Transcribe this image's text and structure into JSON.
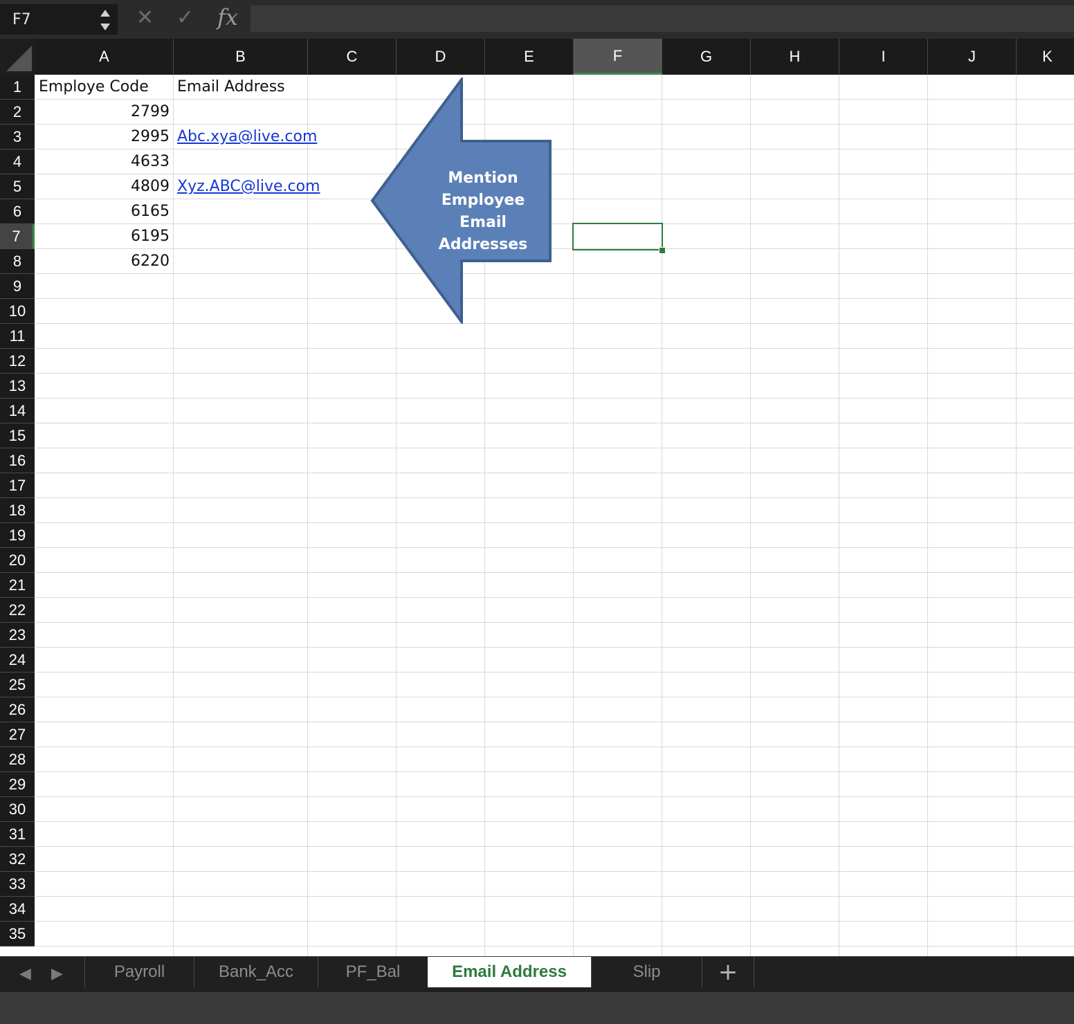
{
  "formula_bar": {
    "name_box": "F7",
    "cancel_icon": "✕",
    "confirm_icon": "✓",
    "fx_label": "fx",
    "formula_value": ""
  },
  "columns": [
    "A",
    "B",
    "C",
    "D",
    "E",
    "F",
    "G",
    "H",
    "I",
    "J",
    "K"
  ],
  "rows": [
    "1",
    "2",
    "3",
    "4",
    "5",
    "6",
    "7",
    "8",
    "9",
    "10",
    "11",
    "12",
    "13",
    "14",
    "15",
    "16",
    "17",
    "18",
    "19",
    "20",
    "21",
    "22",
    "23",
    "24",
    "25",
    "26",
    "27",
    "28",
    "29",
    "30",
    "31",
    "32",
    "33",
    "34",
    "35"
  ],
  "active_cell": {
    "column": "F",
    "row": "7"
  },
  "cells": {
    "A1": "Employe Code",
    "B1": "Email Address",
    "A2": "2799",
    "A3": "2995",
    "B3": "Abc.xya@live.com",
    "A4": "4633",
    "A5": "4809",
    "B5": "Xyz.ABC@live.com",
    "A6": "6165",
    "A7": "6195",
    "A8": "6220"
  },
  "callout": {
    "text": "Mention Employee Email Addresses",
    "fill_color": "#5b80b8",
    "border_color": "#3f5f8f"
  },
  "sheet_tabs": [
    "Payroll",
    "Bank_Acc",
    "PF_Bal",
    "Email Address",
    "Slip"
  ],
  "active_sheet": "Email Address",
  "add_sheet_label": "+",
  "tab_nav": {
    "prev": "◀",
    "next": "▶"
  },
  "colors": {
    "accent": "#2f7a3f",
    "link": "#1437d6"
  }
}
